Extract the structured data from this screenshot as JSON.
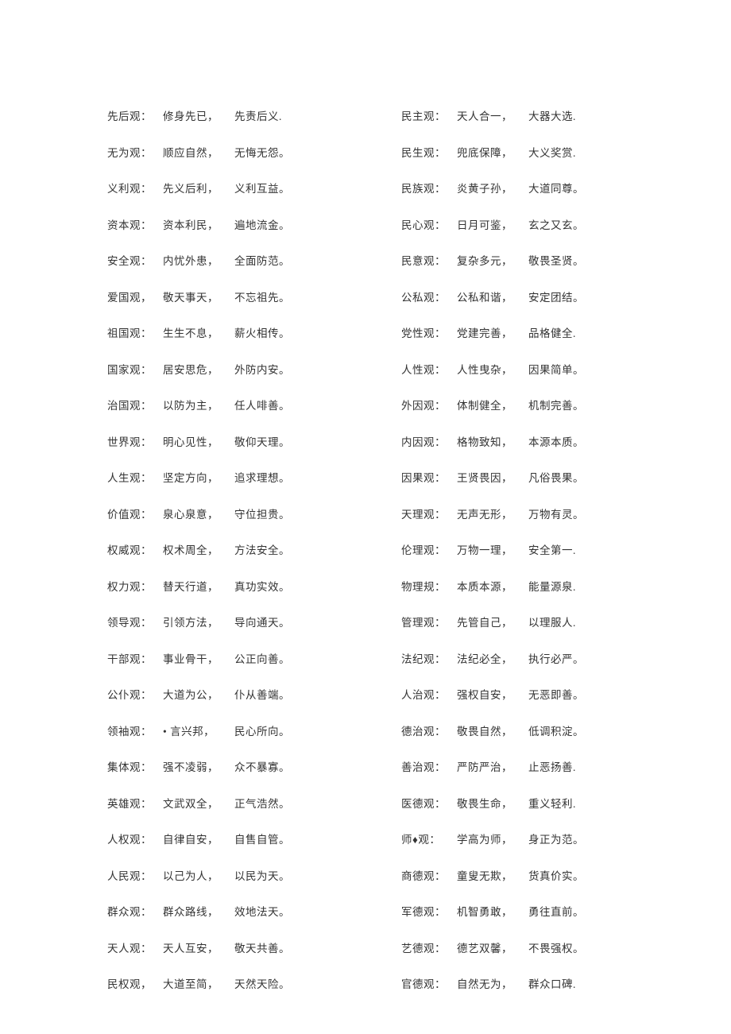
{
  "left": [
    {
      "label": "先后观：",
      "p1": "修身先已，",
      "p2": "先责后义."
    },
    {
      "label": "无为观：",
      "p1": "顺应自然，",
      "p2": "无悔无怨。"
    },
    {
      "label": "义利观：",
      "p1": "先义后利，",
      "p2": "义利互益。"
    },
    {
      "label": "资本观：",
      "p1": "资本利民，",
      "p2": "遍地流金。"
    },
    {
      "label": "安全观：",
      "p1": "内忧外患，",
      "p2": "全面防范。"
    },
    {
      "label": "爱国观，",
      "p1": "敬天事天，",
      "p2": "不忘祖先。"
    },
    {
      "label": "祖国观：",
      "p1": "生生不息，",
      "p2": "薪火相传。"
    },
    {
      "label": "国家观：",
      "p1": "居安思危，",
      "p2": "外防内安。"
    },
    {
      "label": "治国观：",
      "p1": "以防为主，",
      "p2": "任人啡善。"
    },
    {
      "label": "世界观：",
      "p1": "明心见性，",
      "p2": "敬仰天理。"
    },
    {
      "label": "人生观：",
      "p1": "坚定方向，",
      "p2": "追求理想。"
    },
    {
      "label": "价值观：",
      "p1": "泉心泉意，",
      "p2": "守位担贵。"
    },
    {
      "label": "权威观：",
      "p1": "权术周全，",
      "p2": "方法安全。"
    },
    {
      "label": "权力观：",
      "p1": "替天行道，",
      "p2": "真功实效。"
    },
    {
      "label": "领导观：",
      "p1": "引领方法，",
      "p2": "导向通天。"
    },
    {
      "label": "干部观：",
      "p1": "事业骨干，",
      "p2": "公正向善。"
    },
    {
      "label": "公仆观：",
      "p1": "大道为公，",
      "p2": "仆从善端。"
    },
    {
      "label": "领袖观：",
      "p1": "  • 言兴邦，",
      "p2": "民心所向。"
    },
    {
      "label": "集体观：",
      "p1": "强不凌弱，",
      "p2": "众不暴寡。"
    },
    {
      "label": "英雄观：",
      "p1": "文武双全，",
      "p2": "正气浩然。"
    },
    {
      "label": "人权观：",
      "p1": "自律自安，",
      "p2": "自售自管。"
    },
    {
      "label": "人民观：",
      "p1": "以己为人，",
      "p2": "以民为天。"
    },
    {
      "label": "群众观：",
      "p1": "群众路线，",
      "p2": "效地法天。"
    },
    {
      "label": "天人观：",
      "p1": "天人互安，",
      "p2": "敬天共善。"
    },
    {
      "label": "民权观，",
      "p1": "大道至简，",
      "p2": "天然天险。"
    }
  ],
  "right": [
    {
      "label": "民主观：",
      "p1": "天人合一，",
      "p2": "大器大选."
    },
    {
      "label": "民生观：",
      "p1": "兜底保障，",
      "p2": "大义奖赏."
    },
    {
      "label": "民族观：",
      "p1": "炎黄子孙，",
      "p2": "大道同尊。"
    },
    {
      "label": "民心观：",
      "p1": "日月可鉴，",
      "p2": "玄之又玄。"
    },
    {
      "label": "民意观：",
      "p1": "复杂多元，",
      "p2": "敬畏圣贤。"
    },
    {
      "label": "公私观：",
      "p1": "公私和谐，",
      "p2": "安定团结。"
    },
    {
      "label": "党性观：",
      "p1": "党建完善，",
      "p2": "品格健全."
    },
    {
      "label": "人性观：",
      "p1": "人性曳杂，",
      "p2": "因果简单。"
    },
    {
      "label": "外因观：",
      "p1": "体制健全，",
      "p2": "机制完善。"
    },
    {
      "label": "内因观：",
      "p1": "格物致知，",
      "p2": "本源本质。"
    },
    {
      "label": "因果观：",
      "p1": "王贤畏因，",
      "p2": "凡俗畏果。"
    },
    {
      "label": "天理观：",
      "p1": "无声无形，",
      "p2": "万物有灵。"
    },
    {
      "label": "伦理观：",
      "p1": "万物一理，",
      "p2": "安全第一."
    },
    {
      "label": "物理规：",
      "p1": "本质本源，",
      "p2": "能量源泉."
    },
    {
      "label": "管理观：",
      "p1": "先管自己，",
      "p2": "以理服人."
    },
    {
      "label": "法纪观：",
      "p1": "法纪必全，",
      "p2": "执行必严。"
    },
    {
      "label": "人治观：",
      "p1": "强权自安，",
      "p2": "无恶即善。"
    },
    {
      "label": "德治观：",
      "p1": "敬畏自然，",
      "p2": "低调积淀。"
    },
    {
      "label": "善治观：",
      "p1": "严防严治，",
      "p2": "止恶扬善."
    },
    {
      "label": "医德观：",
      "p1": "敬畏生命，",
      "p2": "重义轻利."
    },
    {
      "label": "师♦观：",
      "p1": "学高为师，",
      "p2": "身正为范。"
    },
    {
      "label": "商德观：",
      "p1": "童叟无欺，",
      "p2": "货真价实。"
    },
    {
      "label": "军德观：",
      "p1": "机智勇敢，",
      "p2": "勇往直前。"
    },
    {
      "label": "艺德观：",
      "p1": "德艺双馨，",
      "p2": "不畏强权。"
    },
    {
      "label": "官德观：",
      "p1": "自然无为，",
      "p2": "群众口碑."
    }
  ]
}
